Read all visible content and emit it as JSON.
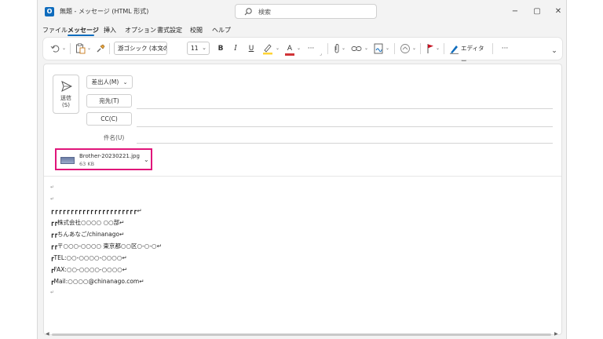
{
  "window": {
    "title": "無題 - メッセージ (HTML 形式)",
    "search_placeholder": "検索",
    "minimize": "−",
    "restore": "▢",
    "close": "✕"
  },
  "menu": [
    "ファイル",
    "メッセージ",
    "挿入",
    "オプション",
    "書式設定",
    "校閲",
    "ヘルプ"
  ],
  "active_menu": "メッセージ",
  "ribbon": {
    "font_name": "游ゴシック (本文の",
    "font_size": "11",
    "bold": "B",
    "italic": "I",
    "underline": "U",
    "font_color_letter": "A",
    "more": "···",
    "editor_label": "エディター",
    "overflow": "···",
    "collapse": "⌄"
  },
  "compose": {
    "send_label_line1": "送信",
    "send_label_line2": "(S)",
    "from_button": "差出人(M)",
    "to_button": "宛先(T)",
    "cc_button": "CC(C)",
    "subject_label": "件名(U)"
  },
  "attachment": {
    "name": "Brother-20230221.jpg",
    "size": "63 KB"
  },
  "body_lines": [
    "↵",
    "↵",
    "┏┏┏┏┏┏┏┏┏┏┏┏┏┏┏┏┏┏┏┏┏┏↵",
    "┏┏株式会社○○○○ ○○部↵",
    "┏┏ちんあなご/chinanago↵",
    "┏┏〒○○○-○○○○ 東京都○○区○-○-○↵",
    "┏TEL:○○-○○○○-○○○○↵",
    "┏FAX:○○-○○○○-○○○○↵",
    "┏Mail:○○○○@chinanago.com↵",
    "↵"
  ],
  "colors": {
    "accent": "#0f6cbd",
    "highlight_border": "#e0157a",
    "font_color_red": "#d13438",
    "flag_red": "#c50f1f",
    "highlighter_yellow": "#ffd335"
  }
}
